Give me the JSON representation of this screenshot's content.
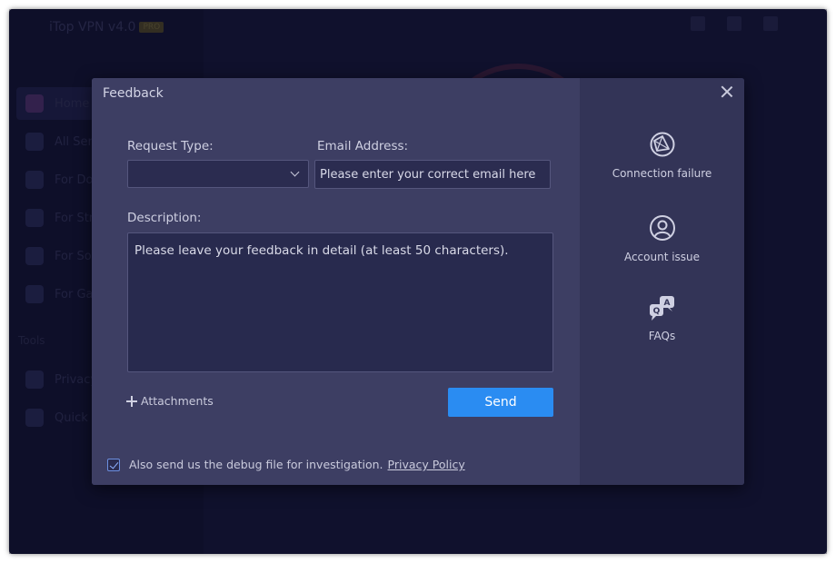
{
  "background_app": {
    "title": "iTop VPN v4.0",
    "badge": "PRO",
    "nav": [
      {
        "label": "Home"
      },
      {
        "label": "All Servers"
      },
      {
        "label": "For Download"
      },
      {
        "label": "For Streaming"
      },
      {
        "label": "For Social"
      },
      {
        "label": "For Gaming"
      }
    ],
    "tools_section": "Tools",
    "tools": [
      {
        "label": "Privacy"
      },
      {
        "label": "Quick"
      }
    ]
  },
  "dialog": {
    "title": "Feedback",
    "request_type_label": "Request Type:",
    "request_type_value": "",
    "email_label": "Email Address:",
    "email_placeholder": "Please enter your correct email here",
    "description_label": "Description:",
    "description_placeholder": "Please leave your feedback in detail (at least 50 characters).",
    "attachments_label": "Attachments",
    "send_label": "Send",
    "debug_text": "Also send us the debug file for investigation.",
    "privacy_label": "Privacy Policy",
    "debug_checked": true
  },
  "sidebar": {
    "items": [
      {
        "label": "Connection failure",
        "icon": "globe-network-icon"
      },
      {
        "label": "Account issue",
        "icon": "user-circle-icon"
      },
      {
        "label": "FAQs",
        "icon": "faq-chat-icon"
      }
    ]
  },
  "colors": {
    "accent": "#2a8cf2",
    "dialog_bg": "#3d3e63",
    "dialog_side_bg": "#333457"
  }
}
